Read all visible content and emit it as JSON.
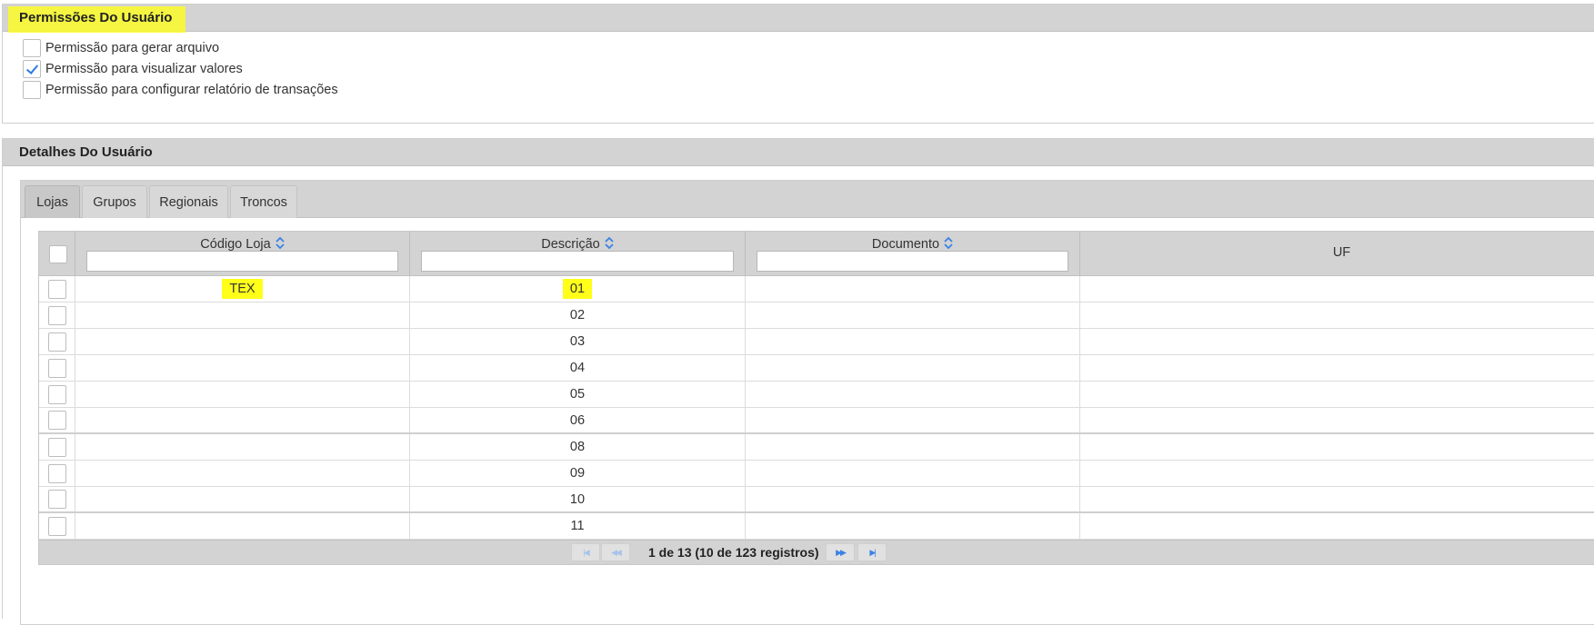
{
  "permissions_panel": {
    "title": "Permissões Do Usuário",
    "items": [
      {
        "label": "Permissão para gerar arquivo",
        "checked": false
      },
      {
        "label": "Permissão para visualizar valores",
        "checked": true
      },
      {
        "label": "Permissão para configurar relatório de transações",
        "checked": false
      }
    ]
  },
  "details_panel": {
    "title": "Detalhes Do Usuário",
    "tabs": [
      {
        "label": "Lojas",
        "active": true
      },
      {
        "label": "Grupos",
        "active": false
      },
      {
        "label": "Regionais",
        "active": false
      },
      {
        "label": "Troncos",
        "active": false
      }
    ],
    "table": {
      "columns": [
        {
          "label": "Código Loja",
          "sortable": true,
          "filter_value": ""
        },
        {
          "label": "Descrição",
          "sortable": true,
          "filter_value": ""
        },
        {
          "label": "Documento",
          "sortable": true,
          "filter_value": ""
        },
        {
          "label": "UF",
          "sortable": false
        }
      ],
      "rows": [
        {
          "codigo": "TEX",
          "descricao": "01",
          "documento": "",
          "uf": ""
        },
        {
          "codigo": "",
          "descricao": "02",
          "documento": "",
          "uf": ""
        },
        {
          "codigo": "",
          "descricao": "03",
          "documento": "",
          "uf": ""
        },
        {
          "codigo": "",
          "descricao": "04",
          "documento": "",
          "uf": ""
        },
        {
          "codigo": "",
          "descricao": "05",
          "documento": "",
          "uf": ""
        },
        {
          "codigo": "",
          "descricao": "06",
          "documento": "",
          "uf": ""
        },
        {
          "codigo": "",
          "descricao": "08",
          "documento": "",
          "uf": ""
        },
        {
          "codigo": "",
          "descricao": "09",
          "documento": "",
          "uf": ""
        },
        {
          "codigo": "",
          "descricao": "10",
          "documento": "",
          "uf": ""
        },
        {
          "codigo": "",
          "descricao": "11",
          "documento": "",
          "uf": ""
        }
      ],
      "pagination": {
        "info": "1 de 13 (10 de 123 registros)",
        "first_icon": "first-page-icon",
        "prev_icon": "prev-page-icon",
        "next_icon": "next-page-icon",
        "last_icon": "last-page-icon"
      }
    }
  },
  "colors": {
    "highlight": "#ffff1a",
    "header_bg": "#d3d3d3",
    "check_accent": "#2a7ae2",
    "pager_accent": "#3a82e4"
  }
}
